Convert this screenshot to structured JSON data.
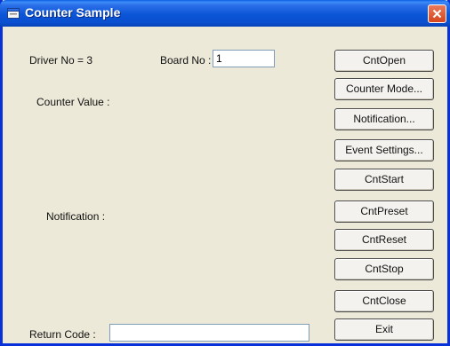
{
  "window": {
    "title": "Counter Sample"
  },
  "labels": {
    "driver_no": "Driver No = 3",
    "board_no": "Board No :",
    "counter_value": "Counter Value :",
    "notification": "Notification :",
    "return_code": "Return Code :"
  },
  "inputs": {
    "board_no_value": "1",
    "return_code_value": ""
  },
  "buttons": [
    "CntOpen",
    "Counter Mode...",
    "Notification...",
    "Event Settings...",
    "CntStart",
    "CntPreset",
    "CntReset",
    "CntStop",
    "CntClose",
    "Exit"
  ]
}
